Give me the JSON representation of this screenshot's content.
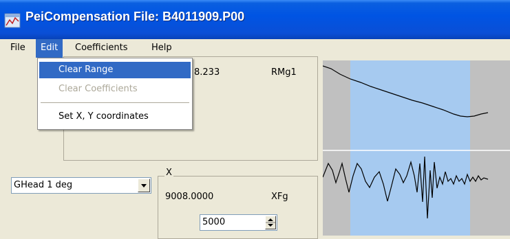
{
  "window": {
    "title": "PeiCompensation File: B4011909.P00"
  },
  "menubar": {
    "items": [
      "File",
      "Edit",
      "Coefficients",
      "Help"
    ]
  },
  "edit_menu": {
    "items": [
      {
        "label": "Clear Range",
        "state": "highlighted"
      },
      {
        "label": "Clear Coefficients",
        "state": "disabled"
      },
      {
        "label": "Set X, Y coordinates",
        "state": "enabled"
      }
    ]
  },
  "upper_group": {
    "value": "8.233",
    "label": "RMg1"
  },
  "combo": {
    "value": "GHead  1 deg"
  },
  "x_group": {
    "title": "X",
    "value": "9008.0000",
    "label": "XFg",
    "spin_value": "5000"
  },
  "colors": {
    "titlebar": "#0054e3",
    "selection": "#316ac5",
    "range": "#a6caf0",
    "chart_bg": "#c0c0c0"
  },
  "icons": [
    "app-chart-icon",
    "combo-dropdown-arrow-icon",
    "spin-updown-icon"
  ]
}
